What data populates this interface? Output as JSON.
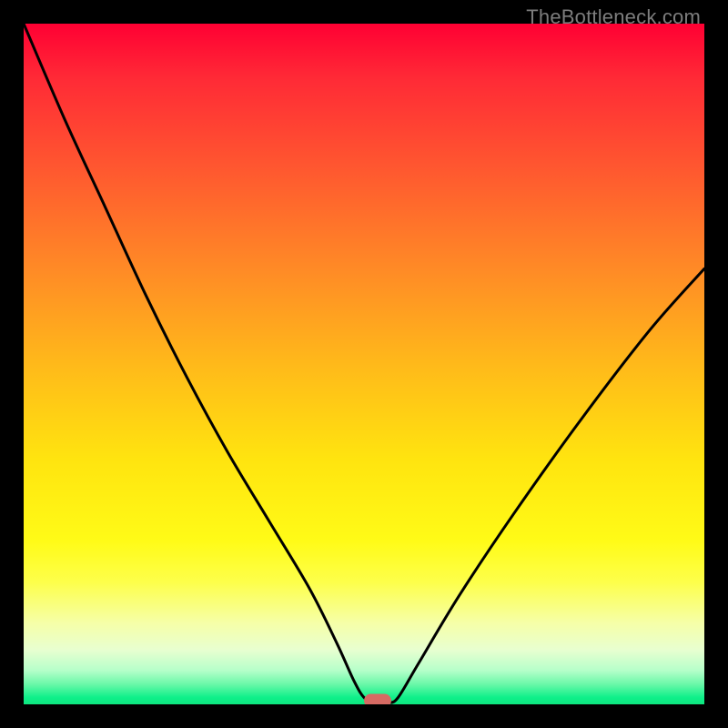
{
  "watermark": "TheBottleneck.com",
  "chart_data": {
    "type": "line",
    "title": "",
    "xlabel": "",
    "ylabel": "",
    "xlim": [
      0,
      100
    ],
    "ylim": [
      0,
      100
    ],
    "grid": false,
    "legend": false,
    "series": [
      {
        "name": "bottleneck-curve",
        "x": [
          0,
          6,
          12,
          18,
          24,
          30,
          36,
          42,
          46,
          48.5,
          50,
          51.5,
          53.5,
          55,
          58,
          64,
          72,
          82,
          92,
          100
        ],
        "y": [
          100,
          86,
          73,
          60,
          48,
          37,
          27,
          17,
          9,
          3.5,
          1,
          0.2,
          0.2,
          1,
          6,
          16,
          28,
          42,
          55,
          64
        ]
      }
    ],
    "marker": {
      "x": 52,
      "y": 0.6,
      "shape": "pill",
      "color": "#d66a63"
    },
    "background": {
      "type": "vertical-gradient",
      "stops": [
        {
          "pos": 0.0,
          "color": "#ff0033"
        },
        {
          "pos": 0.5,
          "color": "#ffe40f"
        },
        {
          "pos": 0.88,
          "color": "#f6ffa7"
        },
        {
          "pos": 1.0,
          "color": "#0ee67f"
        }
      ]
    }
  }
}
